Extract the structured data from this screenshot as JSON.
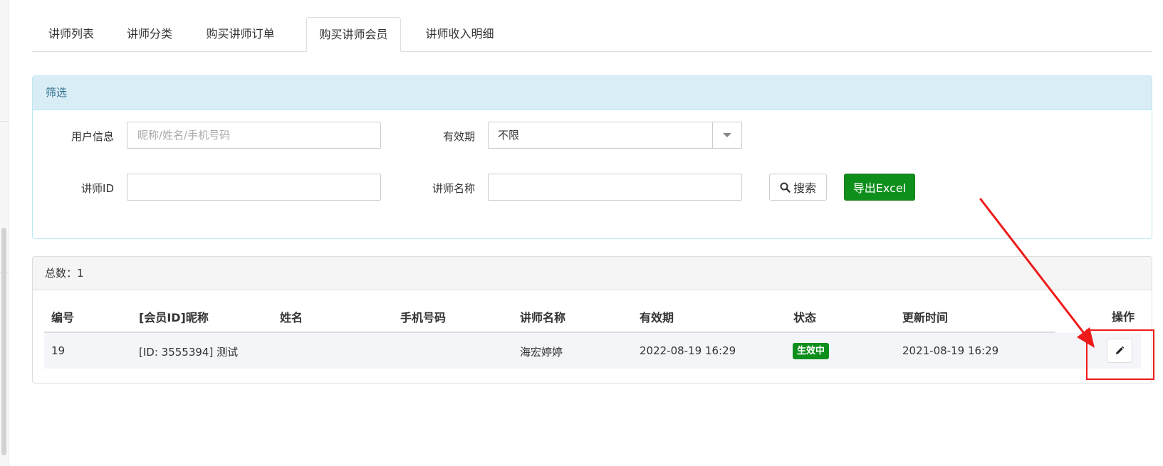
{
  "tabs": [
    {
      "label": "讲师列表",
      "active": false
    },
    {
      "label": "讲师分类",
      "active": false
    },
    {
      "label": "购买讲师订单",
      "active": false
    },
    {
      "label": "购买讲师会员",
      "active": true
    },
    {
      "label": "讲师收入明细",
      "active": false
    }
  ],
  "filter": {
    "title": "筛选",
    "user_info_label": "用户信息",
    "user_info_placeholder": "昵称/姓名/手机号码",
    "user_info_value": "",
    "validity_label": "有效期",
    "validity_value": "不限",
    "lecturer_id_label": "讲师ID",
    "lecturer_id_value": "",
    "lecturer_name_label": "讲师名称",
    "lecturer_name_value": "",
    "search_button": "搜索",
    "export_button": "导出Excel",
    "export_color": "#0e8f1c"
  },
  "list": {
    "total_text": "总数：1",
    "columns": [
      "编号",
      "[会员ID]昵称",
      "姓名",
      "手机号码",
      "讲师名称",
      "有效期",
      "状态",
      "更新时间",
      "操作"
    ],
    "rows": [
      {
        "id": "19",
        "member": "[ID: 3555394] 测试",
        "name": "",
        "phone": "",
        "lecturer": "海宏婷婷",
        "validity": "2022-08-19 16:29",
        "status": "生效中",
        "updated": "2021-08-19 16:29",
        "action_icon": "pencil-icon"
      }
    ]
  },
  "annotation": {
    "color": "#ee1a1a"
  }
}
